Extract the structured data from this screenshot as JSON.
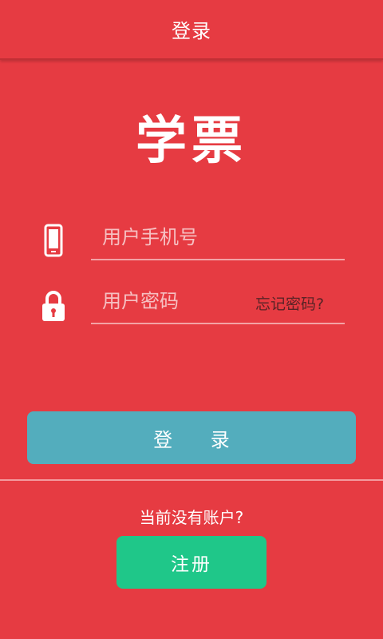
{
  "topbar": {
    "title": "登录"
  },
  "logo": {
    "text": "学票"
  },
  "form": {
    "phone": {
      "placeholder": "用户手机号",
      "value": ""
    },
    "password": {
      "placeholder": "用户密码",
      "value": ""
    },
    "forgot_label": "忘记密码?"
  },
  "actions": {
    "login_label": "登 录",
    "no_account_text": "当前没有账户?",
    "register_label": "注册"
  },
  "icons": {
    "phone": "phone-icon",
    "lock": "lock-icon"
  },
  "colors": {
    "background": "#e63b42",
    "login_button": "#53adbd",
    "register_button": "#1fc789",
    "forgot_text": "#5a2326"
  }
}
